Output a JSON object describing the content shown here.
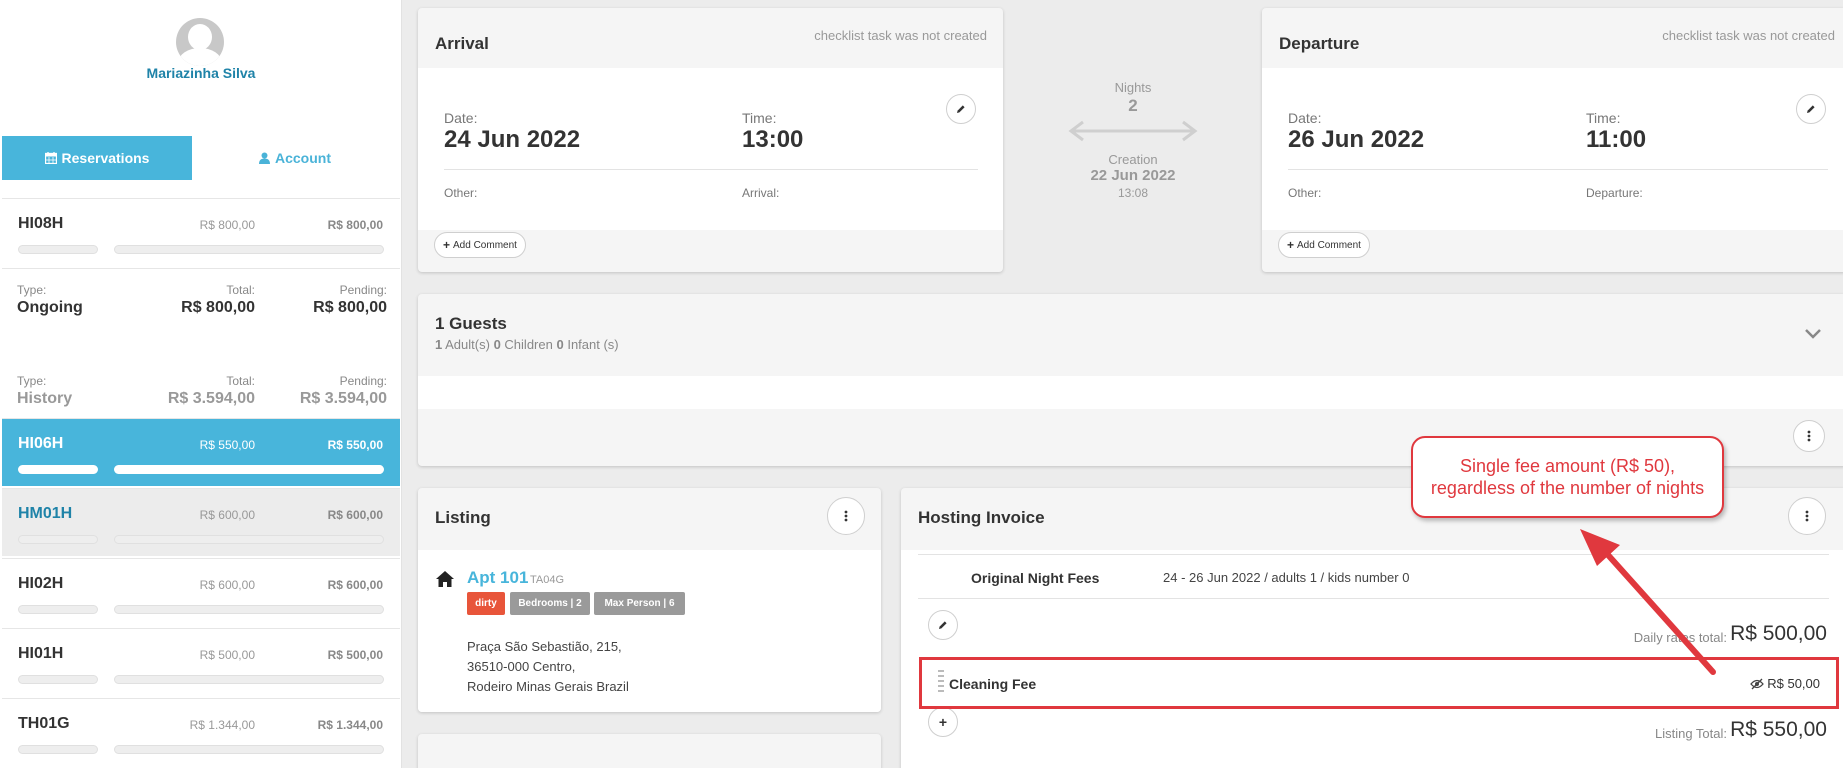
{
  "user": {
    "name": "Mariazinha Silva"
  },
  "tabs": [
    {
      "label": "Reservations",
      "icon": "calendar-icon",
      "active": true
    },
    {
      "label": "Account",
      "icon": "user-icon",
      "active": false
    }
  ],
  "reservations": [
    {
      "code": "HI08H",
      "total": "R$ 800,00",
      "pending": "R$ 800,00",
      "state": "normal"
    },
    {
      "code": "HI06H",
      "total": "R$ 550,00",
      "pending": "R$ 550,00",
      "state": "selected"
    },
    {
      "code": "HM01H",
      "total": "R$ 600,00",
      "pending": "R$ 600,00",
      "state": "hover"
    },
    {
      "code": "HI02H",
      "total": "R$ 600,00",
      "pending": "R$ 600,00",
      "state": "normal"
    },
    {
      "code": "HI01H",
      "total": "R$ 500,00",
      "pending": "R$ 500,00",
      "state": "normal"
    },
    {
      "code": "TH01G",
      "total": "R$ 1.344,00",
      "pending": "R$ 1.344,00",
      "state": "normal"
    }
  ],
  "summaries": {
    "ongoing": {
      "type_label": "Type:",
      "type": "Ongoing",
      "total_label": "Total:",
      "total": "R$ 800,00",
      "pending_label": "Pending:",
      "pending": "R$ 800,00"
    },
    "history": {
      "type_label": "Type:",
      "type": "History",
      "total_label": "Total:",
      "total": "R$ 3.594,00",
      "pending_label": "Pending:",
      "pending": "R$ 3.594,00"
    }
  },
  "arrival": {
    "title": "Arrival",
    "note": "checklist task was not created",
    "date_label": "Date:",
    "date": "24 Jun 2022",
    "time_label": "Time:",
    "time": "13:00",
    "other_label": "Other:",
    "extra_label": "Arrival:",
    "comment_btn": "Add Comment"
  },
  "departure": {
    "title": "Departure",
    "note": "checklist task was not created",
    "date_label": "Date:",
    "date": "26 Jun 2022",
    "time_label": "Time:",
    "time": "11:00",
    "other_label": "Other:",
    "extra_label": "Departure:",
    "comment_btn": "Add Comment"
  },
  "stay": {
    "nights_label": "Nights",
    "nights": "2",
    "creation_label": "Creation",
    "creation_date": "22 Jun 2022",
    "creation_time": "13:08"
  },
  "guests": {
    "title": "1 Guests",
    "adults": "1",
    "adults_label": "Adult(s)",
    "children": "0",
    "children_label": "Children",
    "infants": "0",
    "infants_label": "Infant (s)"
  },
  "listing": {
    "title": "Listing",
    "name": "Apt 101",
    "code": "TA04G",
    "badges": [
      {
        "label": "dirty",
        "color": "#e8553a"
      },
      {
        "label": "Bedrooms | 2",
        "color": "#9a9a9a"
      },
      {
        "label": "Max Person | 6",
        "color": "#9a9a9a"
      }
    ],
    "address_line1": "Praça São Sebastião, 215,",
    "address_line2": "36510-000 Centro,",
    "address_line3": "Rodeiro Minas Gerais Brazil"
  },
  "invoice": {
    "title": "Hosting Invoice",
    "night_fees_label": "Original Night Fees",
    "night_fees_detail": "24 - 26 Jun 2022  /  adults 1  /  kids number 0",
    "daily_rates_label": "Daily rates total:",
    "daily_rates_total": "R$ 500,00",
    "fee_name": "Cleaning Fee",
    "fee_amount": "R$ 50,00",
    "listing_total_label": "Listing Total:",
    "listing_total": "R$ 550,00"
  },
  "annotation": {
    "line1": "Single fee amount (R$ 50),",
    "line2": "regardless of the number of nights",
    "color": "#e0383e"
  }
}
